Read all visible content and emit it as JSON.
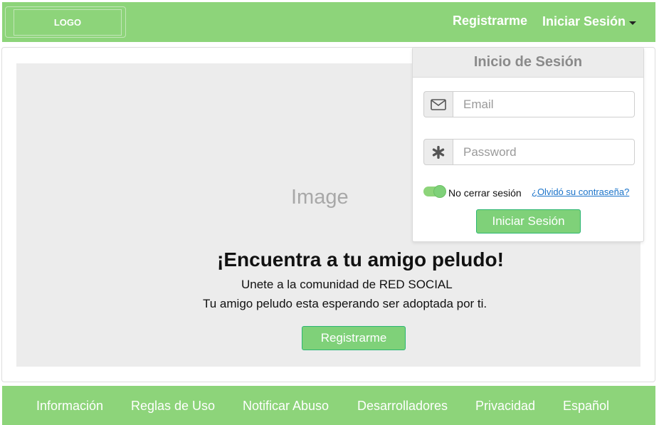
{
  "header": {
    "logo_text": "LOGO",
    "nav_register": "Registrarme",
    "nav_login": "Iniciar Sesión"
  },
  "hero": {
    "image_placeholder": "Image",
    "title": "¡Encuentra a tu amigo peludo!",
    "subtitle_line1": "Unete a la comunidad de RED SOCIAL",
    "subtitle_line2": "Tu amigo peludo esta esperando ser adoptada por ti.",
    "register_button": "Registrarme"
  },
  "login_panel": {
    "title": "Inicio de Sesión",
    "email_placeholder": "Email",
    "password_placeholder": "Password",
    "remember_label": "No cerrar sesión",
    "remember_on": true,
    "forgot_link": "¿Olvidó su contraseña?",
    "submit_button": "Iniciar Sesión",
    "icons": {
      "email": "envelope-icon",
      "password": "asterisk-icon"
    }
  },
  "footer": {
    "links": [
      "Información",
      "Reglas de Uso",
      "Notificar Abuso",
      "Desarrolladores",
      "Privacidad",
      "Español"
    ]
  },
  "colors": {
    "brand_green": "#8dd47a",
    "button_green": "#7fd179",
    "button_border": "#2bb673",
    "link_blue": "#1a73c9",
    "hero_bg": "#ececec"
  }
}
